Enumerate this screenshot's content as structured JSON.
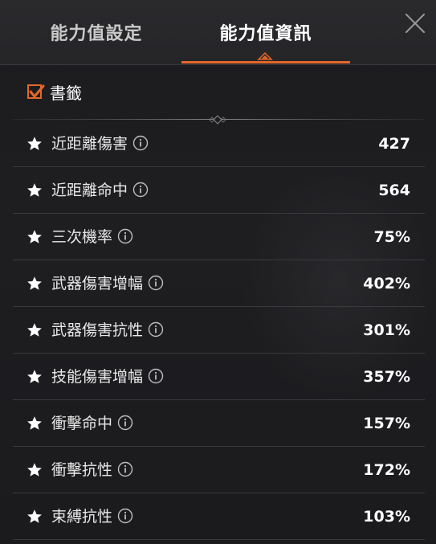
{
  "tabs": [
    {
      "label": "能力值設定"
    },
    {
      "label": "能力值資訊"
    }
  ],
  "active_tab": 1,
  "bookmark": {
    "label": "書籤",
    "checked": true
  },
  "colors": {
    "accent": "#e3672a",
    "text": "#ffffff",
    "muted": "#c9c9c9",
    "row_divider": "#3a3a3e"
  },
  "stats": [
    {
      "name": "近距離傷害",
      "value": "427"
    },
    {
      "name": "近距離命中",
      "value": "564"
    },
    {
      "name": "三次機率",
      "value": "75%"
    },
    {
      "name": "武器傷害增幅",
      "value": "402%"
    },
    {
      "name": "武器傷害抗性",
      "value": "301%"
    },
    {
      "name": "技能傷害增幅",
      "value": "357%"
    },
    {
      "name": "衝擊命中",
      "value": "157%"
    },
    {
      "name": "衝擊抗性",
      "value": "172%"
    },
    {
      "name": "束縛抗性",
      "value": "103%"
    }
  ],
  "icons": {
    "close": "close-icon",
    "star": "star-icon",
    "info": "info-icon",
    "check": "checkmark-icon"
  }
}
